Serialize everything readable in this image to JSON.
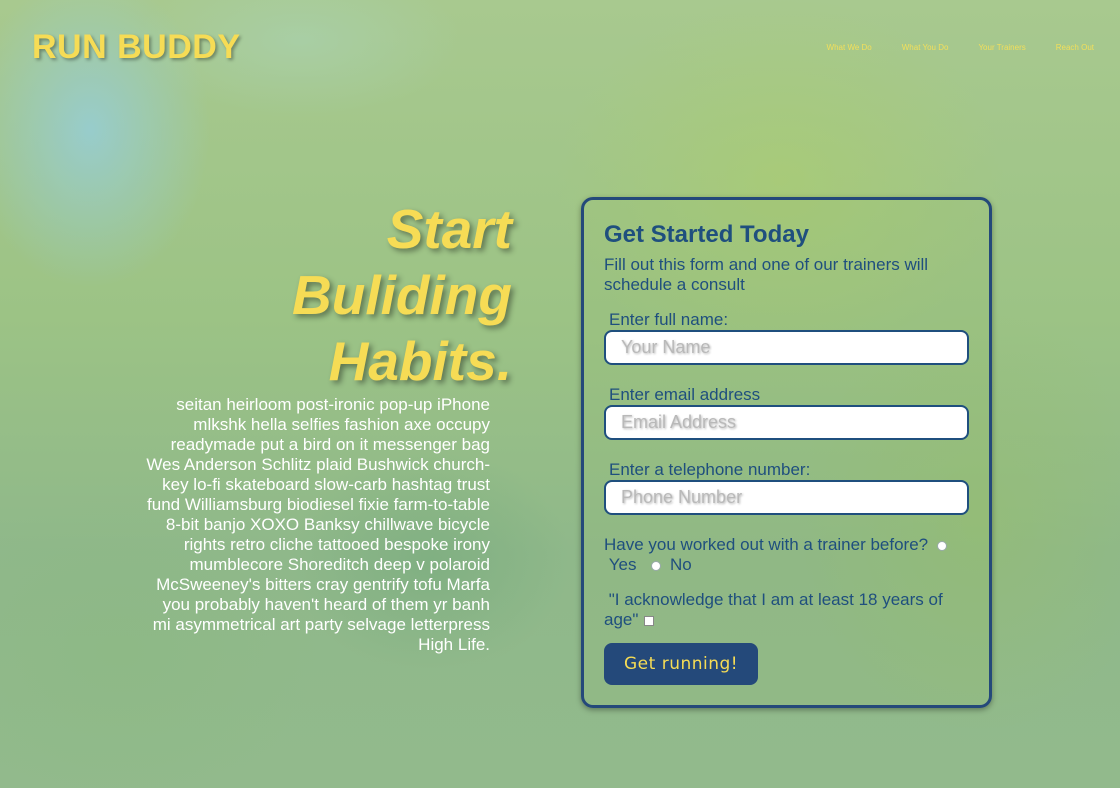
{
  "header": {
    "logo": "RUN BUDDY",
    "nav": [
      "What We Do",
      "What You Do",
      "Your Trainers",
      "Reach Out"
    ]
  },
  "hero": {
    "title_lines": [
      "Start",
      "Buliding",
      "Habits."
    ],
    "text": "seitan heirloom post-ironic pop-up iPhone mlkshk hella selfies fashion axe occupy readymade put a bird on it messenger bag Wes Anderson Schlitz plaid Bushwick church-key lo-fi skateboard slow-carb hashtag trust fund Williamsburg biodiesel fixie farm-to-table 8-bit banjo XOXO Banksy chillwave bicycle rights retro cliche tattooed bespoke irony mumblecore Shoreditch deep v polaroid McSweeney's bitters cray gentrify tofu Marfa you probably haven't heard of them yr banh mi asymmetrical art party selvage letterpress High Life."
  },
  "form": {
    "title": "Get Started Today",
    "intro": "Fill out this form and one of our trainers will schedule a consult",
    "name_label": "Enter full name:",
    "name_placeholder": "Your Name",
    "email_label": "Enter email address",
    "email_placeholder": "Email Address",
    "phone_label": "Enter a telephone number:",
    "phone_placeholder": "Phone Number",
    "question": "Have you worked out with a trainer before?",
    "option_yes": "Yes",
    "option_no": "No",
    "ack": "\"I acknowledge that I am at least 18 years of age\"",
    "submit": "Get running!"
  },
  "colors": {
    "accent_yellow": "#f6dc55",
    "primary_blue": "#24497a"
  }
}
